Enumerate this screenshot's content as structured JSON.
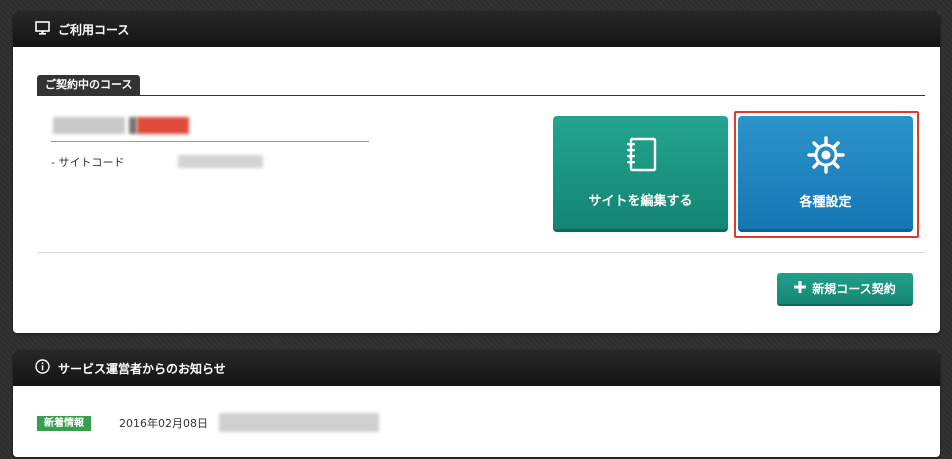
{
  "course_panel": {
    "title": "ご利用コース",
    "icon": "monitor-icon",
    "section_tab": "ご契約中のコース",
    "site_code_label": "- サイトコード",
    "edit_site_button": "サイトを編集する",
    "settings_button": "各種設定",
    "new_course_button": "新規コース契約"
  },
  "news_panel": {
    "title": "サービス運営者からのお知らせ",
    "icon": "info-icon",
    "items": [
      {
        "badge": "新着情報",
        "date": "2016年02月08日"
      }
    ]
  },
  "colors": {
    "edit_button": "#1a9a84",
    "settings_button": "#2287c2",
    "highlight": "#e03a2a",
    "badge": "#3a9e4f"
  }
}
